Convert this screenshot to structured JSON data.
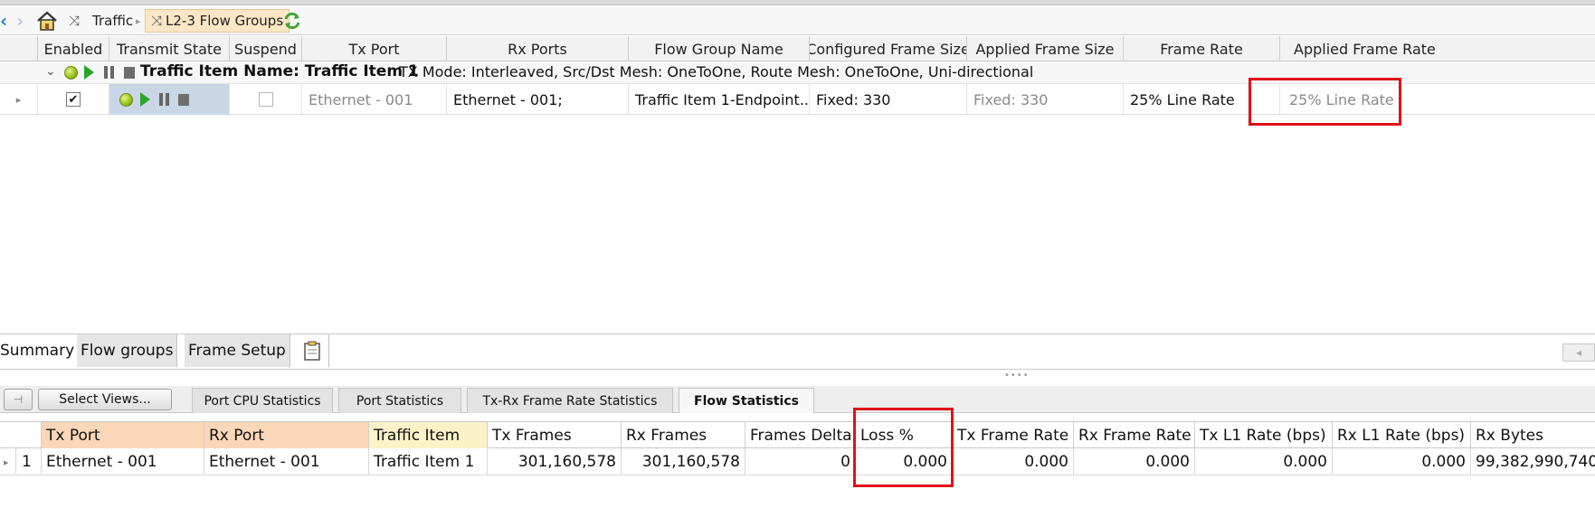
{
  "breadcrumb": {
    "items": [
      "Traffic",
      "L2-3 Flow Groups"
    ]
  },
  "upper_grid": {
    "columns": [
      "Enabled",
      "Transmit State",
      "Suspend",
      "Tx Port",
      "Rx Ports",
      "Flow Group Name",
      "Configured Frame Size",
      "Applied Frame Size",
      "Frame Rate",
      "Applied Frame Rate"
    ],
    "group_row": {
      "title": "Traffic Item Name: Traffic Item 1",
      "details": "TX Mode: Interleaved, Src/Dst Mesh: OneToOne, Route Mesh: OneToOne, Uni-directional"
    },
    "row": {
      "enabled": true,
      "suspend": false,
      "tx_port": "Ethernet - 001",
      "rx_ports": "Ethernet - 001;",
      "flow_group_name": "Traffic Item 1-Endpoint...",
      "configured_frame_size": "Fixed: 330",
      "applied_frame_size": "Fixed: 330",
      "frame_rate": "25% Line Rate",
      "applied_frame_rate": "25% Line Rate"
    }
  },
  "view_tabs": [
    "Summary",
    "Flow groups",
    "Frame Setup"
  ],
  "views_toolbar": {
    "select_views_label": "Select Views...",
    "tabs": [
      "Port CPU Statistics",
      "Port Statistics",
      "Tx-Rx Frame Rate Statistics",
      "Flow Statistics"
    ],
    "active_tab": "Flow Statistics"
  },
  "lower_grid": {
    "columns": [
      "Tx Port",
      "Rx Port",
      "Traffic Item",
      "Tx Frames",
      "Rx Frames",
      "Frames Delta",
      "Loss %",
      "Tx Frame Rate",
      "Rx Frame Rate",
      "Tx L1 Rate (bps)",
      "Rx L1 Rate (bps)",
      "Rx Bytes"
    ],
    "row": {
      "index": "1",
      "tx_port": "Ethernet - 001",
      "rx_port": "Ethernet - 001",
      "traffic_item": "Traffic Item 1",
      "tx_frames": "301,160,578",
      "rx_frames": "301,160,578",
      "frames_delta": "0",
      "loss_pct": "0.000",
      "tx_frame_rate": "0.000",
      "rx_frame_rate": "0.000",
      "tx_l1_rate": "0.000",
      "rx_l1_rate": "0.000",
      "rx_bytes": "99,382,990,740"
    }
  },
  "colors": {
    "highlight_box": "#e0121b",
    "key_header": "#fad7b8",
    "item_header": "#fbf3c8",
    "breadcrumb_current": "#fbe7c6"
  }
}
